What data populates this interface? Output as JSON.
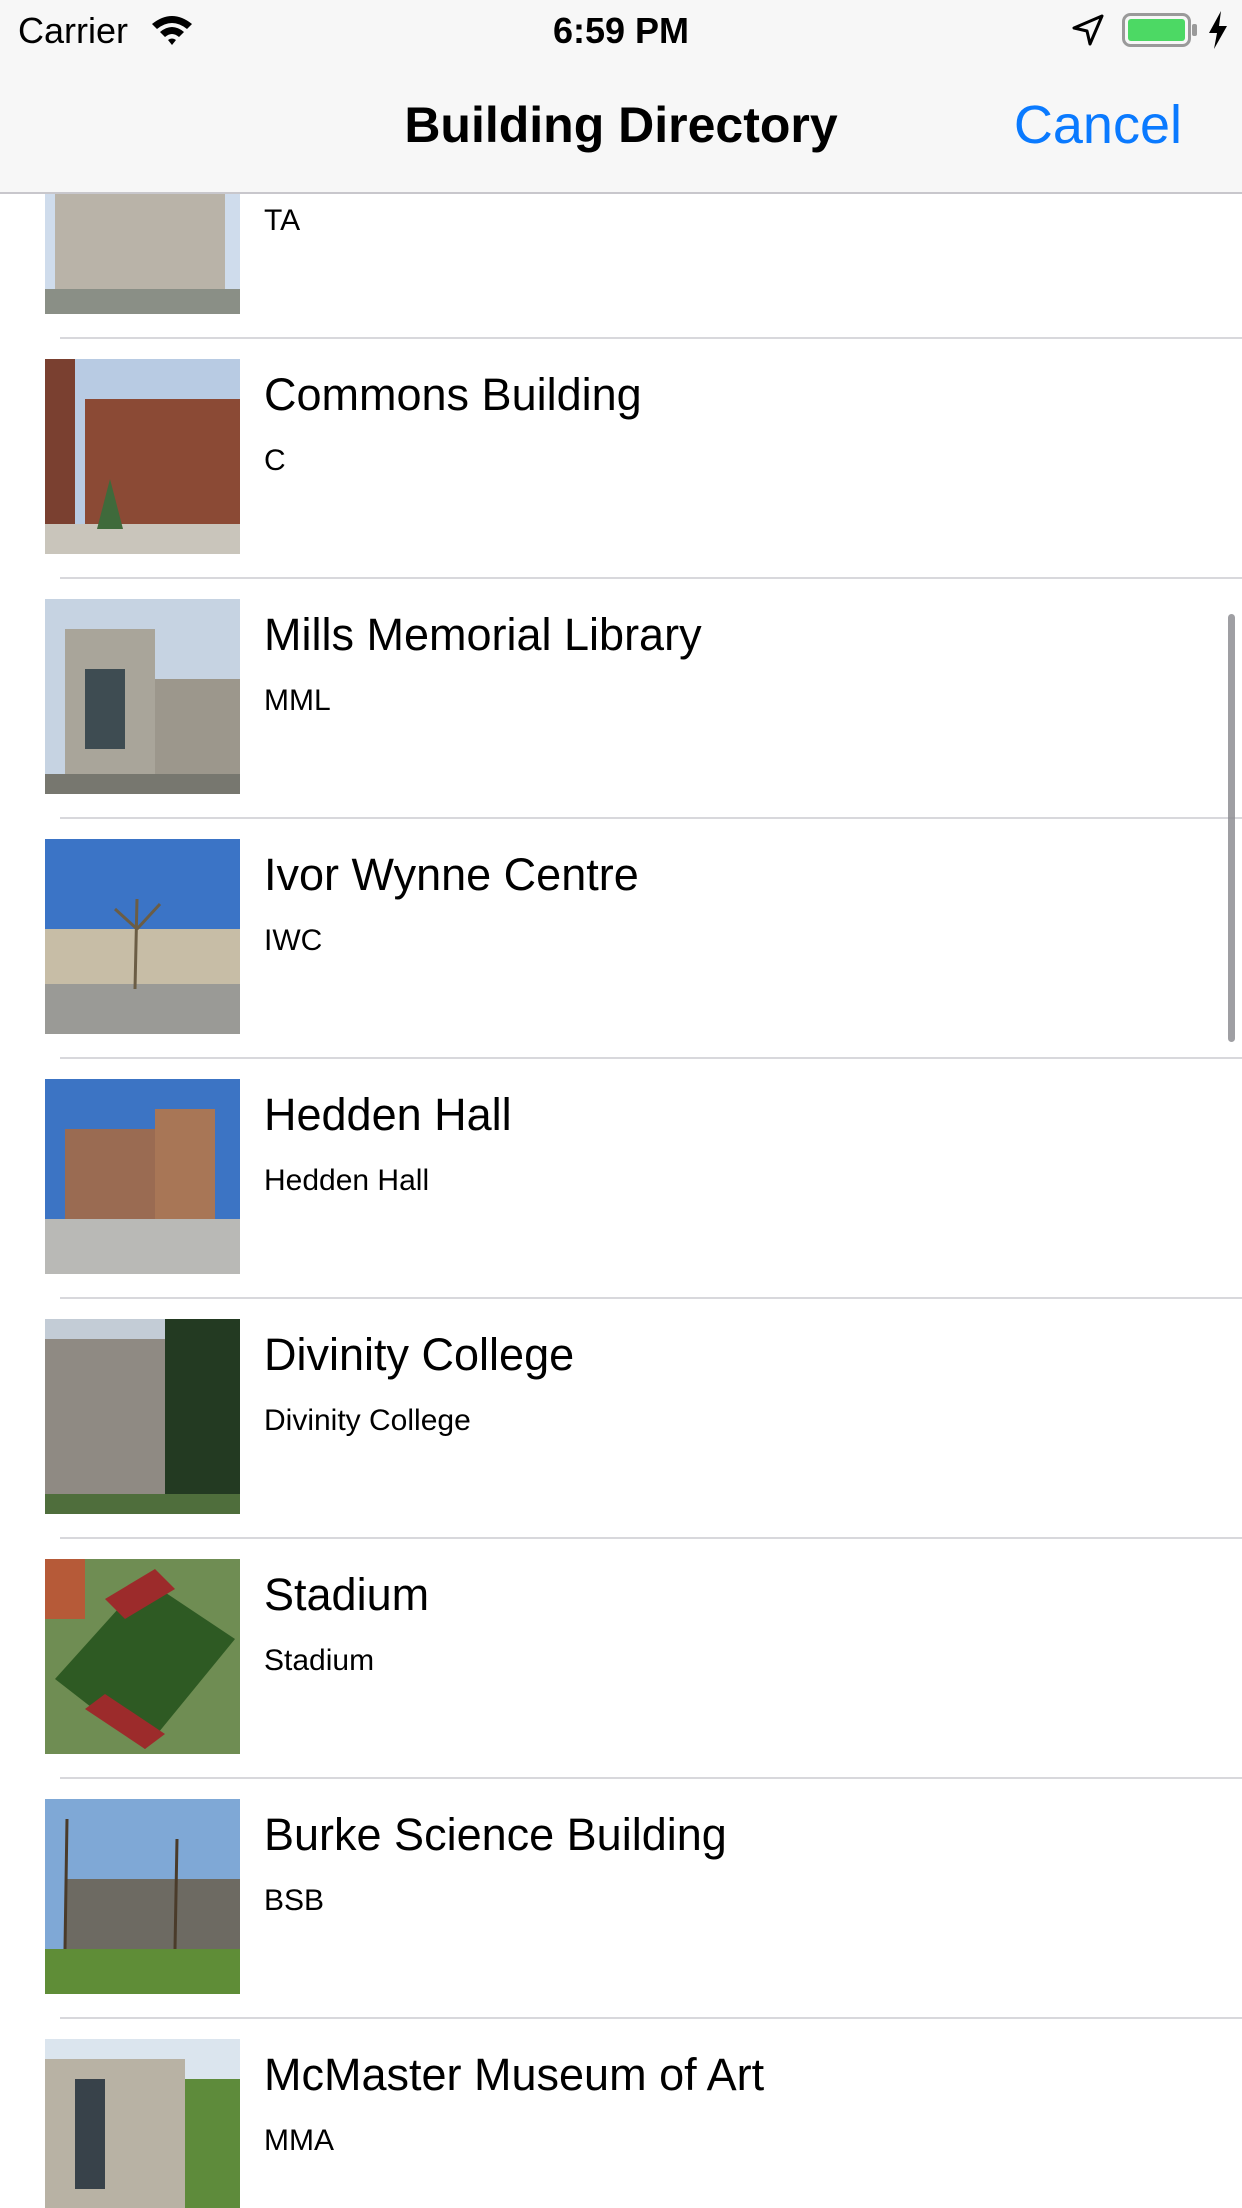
{
  "status": {
    "carrier": "Carrier",
    "time": "6:59 PM",
    "battery_color": "#4cd964"
  },
  "nav": {
    "title": "Building Directory",
    "cancel_label": "Cancel",
    "tint": "#0a7aff"
  },
  "buildings": [
    {
      "name": "",
      "code": "TA",
      "image": "building-photo"
    },
    {
      "name": "Commons Building",
      "code": "C",
      "image": "building-photo"
    },
    {
      "name": "Mills Memorial Library",
      "code": "MML",
      "image": "building-photo"
    },
    {
      "name": "Ivor Wynne Centre",
      "code": "IWC",
      "image": "building-photo"
    },
    {
      "name": "Hedden Hall",
      "code": "Hedden Hall",
      "image": "building-photo"
    },
    {
      "name": "Divinity College",
      "code": "Divinity College",
      "image": "building-photo"
    },
    {
      "name": "Stadium",
      "code": "Stadium",
      "image": "stadium-aerial-photo"
    },
    {
      "name": "Burke Science Building",
      "code": "BSB",
      "image": "building-photo"
    },
    {
      "name": "McMaster Museum of Art",
      "code": "MMA",
      "image": "building-photo"
    }
  ]
}
